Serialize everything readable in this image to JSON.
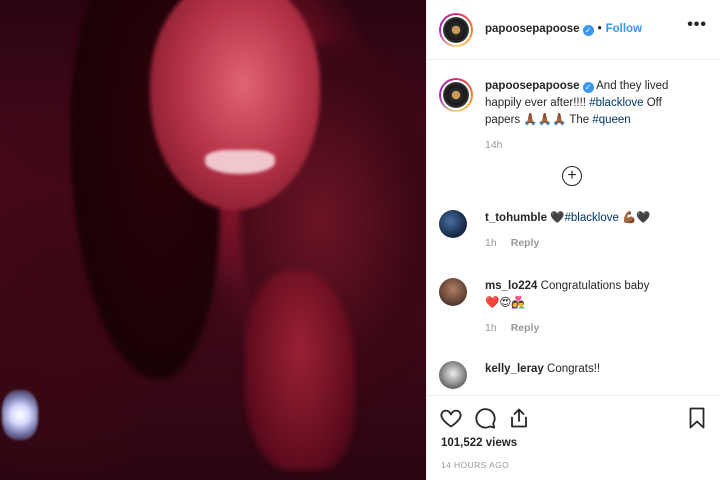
{
  "header": {
    "username": "papoosepapoose",
    "separator": "•",
    "follow_label": "Follow",
    "more_label": "•••",
    "verified_mark": "✓"
  },
  "caption": {
    "username": "papoosepapoose",
    "text_1": "And they lived happily ever after!!!! ",
    "hashtag_1": "#blacklove",
    "text_2": " Off papers ",
    "emojis": "🙏🏾🙏🏾🙏🏾",
    "text_3": " The ",
    "hashtag_2": "#queen",
    "timestamp": "14h"
  },
  "load_more": {
    "label": "+"
  },
  "comments": [
    {
      "username": "t_tohumble",
      "heart_1": "🖤",
      "hashtag": "#blacklove",
      "emoji_2": "💪🏾",
      "heart_3": "🖤",
      "time": "1h",
      "reply_label": "Reply"
    },
    {
      "username": "ms_lo224",
      "text": "Congratulations baby",
      "emojis_line2": "❤️😍👩‍❤️‍👨",
      "time": "1h",
      "reply_label": "Reply"
    },
    {
      "username": "kelly_leray",
      "text": "Congrats!!"
    }
  ],
  "actions": {
    "views": "101,522 views",
    "posted": "14 HOURS AGO"
  },
  "icons": {
    "like": "heart-outline-icon",
    "comment": "speech-bubble-icon",
    "share": "share-upload-icon",
    "save": "bookmark-icon"
  },
  "colors": {
    "link": "#3897f0",
    "hashtag": "#003569",
    "secondary": "#999999"
  }
}
